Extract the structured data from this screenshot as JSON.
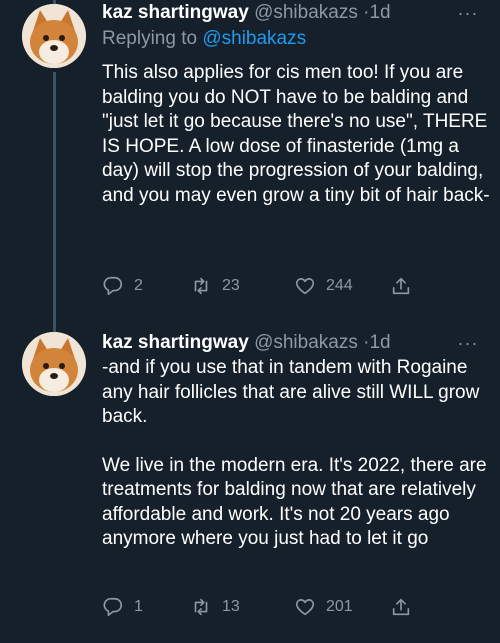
{
  "tweets": [
    {
      "author": {
        "name": "kaz shartingway",
        "handle": "@shibakazs",
        "time": "1d"
      },
      "reply": {
        "prefix": "Replying to ",
        "mention": "@shibakazs"
      },
      "text": [
        "This also applies for cis men too! If you are balding you do NOT have to be balding and \"just let it go because there's no use\", THERE IS HOPE. A low dose of finasteride (1mg a day) will stop the progression of your balding, and you may even grow a tiny bit of hair back-"
      ],
      "stats": {
        "replies": "2",
        "retweets": "23",
        "likes": "244"
      }
    },
    {
      "author": {
        "name": "kaz shartingway",
        "handle": "@shibakazs",
        "time": "1d"
      },
      "text": [
        "-and if you use that in tandem with Rogaine any hair follicles that are alive still WILL grow back.",
        "We live in the modern era. It's 2022, there are treatments for balding now that are relatively affordable and work. It's not 20 years ago anymore where you just had to let it go"
      ],
      "stats": {
        "replies": "1",
        "retweets": "13",
        "likes": "201"
      }
    }
  ],
  "ui": {
    "more_label": "···",
    "separator": "·"
  },
  "colors": {
    "background": "#15202b",
    "secondary_text": "#8b98a5",
    "link": "#1d9bf0",
    "thread_line": "#3d5466"
  },
  "icons": [
    "reply-icon",
    "retweet-icon",
    "like-icon",
    "share-icon",
    "more-icon",
    "avatar"
  ]
}
